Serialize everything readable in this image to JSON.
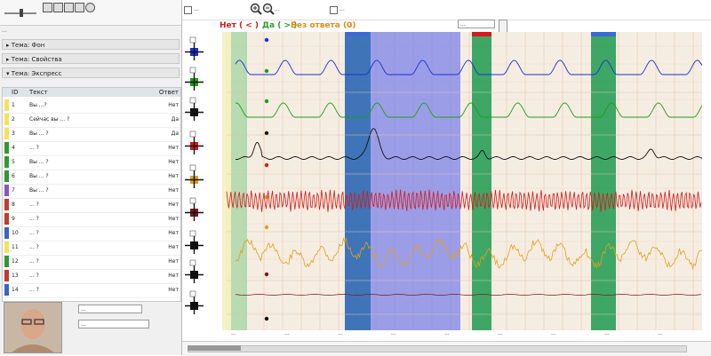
{
  "left_panel": {
    "header_text": "...",
    "topics": [
      {
        "label": "Тема: Фон"
      },
      {
        "label": "Тема: Свойства"
      },
      {
        "label": "Тема: Экспресс"
      }
    ],
    "question_table": {
      "headers": [
        "ID",
        "Текст",
        "Ответ"
      ],
      "rows": [
        {
          "id": "1",
          "text": "Вы ...?",
          "answer": "Нет",
          "color": "#f2e35a"
        },
        {
          "id": "2",
          "text": "Сейчас вы ... ?",
          "answer": "Да",
          "color": "#f2e35a"
        },
        {
          "id": "3",
          "text": "Вы ... ?",
          "answer": "Да",
          "color": "#f2e35a"
        },
        {
          "id": "4",
          "text": "... ?",
          "answer": "Нет",
          "color": "#2f9a2f"
        },
        {
          "id": "5",
          "text": "Вы ... ?",
          "answer": "Нет",
          "color": "#2f9a2f"
        },
        {
          "id": "6",
          "text": "Вы ... ?",
          "answer": "Нет",
          "color": "#2f9a2f"
        },
        {
          "id": "7",
          "text": "Вы ... ?",
          "answer": "Нет",
          "color": "#8a55c2"
        },
        {
          "id": "8",
          "text": "... ?",
          "answer": "Нет",
          "color": "#c23a2f"
        },
        {
          "id": "9",
          "text": "... ?",
          "answer": "Нет",
          "color": "#c23a2f"
        },
        {
          "id": "10",
          "text": "... ?",
          "answer": "Нет",
          "color": "#3a63c2"
        },
        {
          "id": "11",
          "text": "... ?",
          "answer": "Нет",
          "color": "#f2e35a"
        },
        {
          "id": "12",
          "text": "... ?",
          "answer": "Нет",
          "color": "#2f9a2f"
        },
        {
          "id": "13",
          "text": "... ?",
          "answer": "Нет",
          "color": "#c23a2f"
        },
        {
          "id": "14",
          "text": "... ?",
          "answer": "Нет",
          "color": "#3a63c2"
        }
      ]
    },
    "selects": [
      {
        "value": "..."
      },
      {
        "value": "..."
      }
    ]
  },
  "top_bar": {
    "check1_label": "...",
    "zoom_in_icon": "zoom-in-icon",
    "zoom_out_icon": "zoom-out-icon",
    "check2_label": "...",
    "check3_label": "..."
  },
  "answer_bar": {
    "no_label": "Нет ( < )",
    "yes_label": "Да ( > )",
    "none_label": "Без ответа (0)",
    "value": "...",
    "select_value": "..."
  },
  "channels": [
    {
      "name": "...",
      "color": "#1a2fd6"
    },
    {
      "name": "...",
      "color": "#18a018"
    },
    {
      "name": "...",
      "color": "#18a018"
    },
    {
      "name": "...",
      "color": "#111111"
    },
    {
      "name": "...",
      "color": "#d41a1a"
    },
    {
      "name": "...",
      "color": "#e0a01a"
    },
    {
      "name": "...",
      "color": "#7a1a1a"
    },
    {
      "name": "...",
      "color": "#111111"
    }
  ],
  "time_axis": {
    "labels": [
      "...",
      "...",
      "...",
      "...",
      "...",
      "...",
      "...",
      "...",
      "..."
    ]
  },
  "colors": {
    "no_red": "#d41a1a",
    "yes_green": "#2f9a2f",
    "none_orange": "#e08a1a",
    "highlight_blue": "#3a6ad6",
    "highlight_green": "#2fa05a",
    "bg_beige": "#f6ede2"
  }
}
